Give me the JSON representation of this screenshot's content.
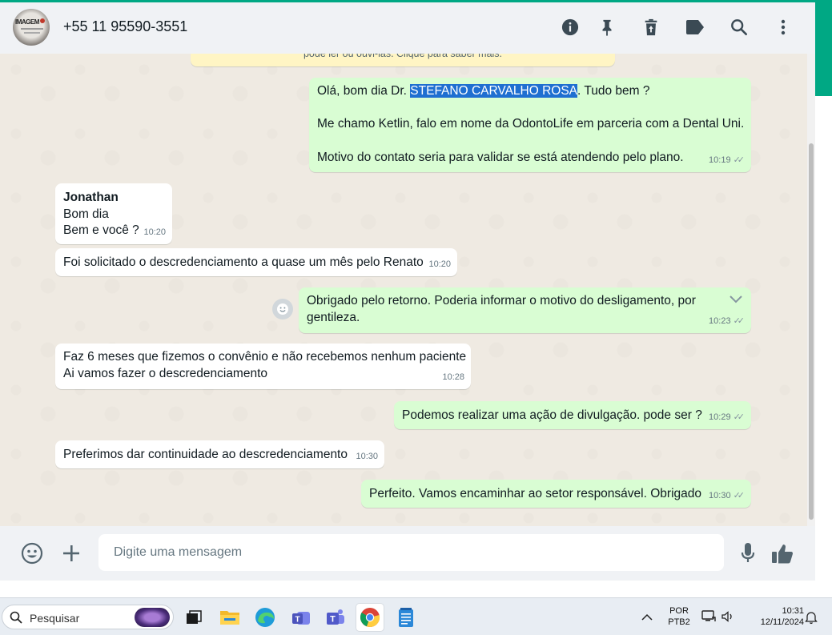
{
  "header": {
    "contact_name": "+55 11 95590-3551",
    "icons": [
      "info-icon",
      "pin-icon",
      "delete-icon",
      "label-icon",
      "search-icon",
      "more-options-icon"
    ]
  },
  "chat": {
    "encryption_notice": "pode ler ou ouvi-las. Clique para saber mais.",
    "messages": [
      {
        "direction": "out",
        "greeting_prefix": "Olá, bom dia Dr. ",
        "highlighted_name": "STEFANO CARVALHO ROSA",
        "greeting_suffix": ". Tudo bem ?",
        "line2": "Me chamo Ketlin, falo em nome da OdontoLife em parceria com a Dental Uni.",
        "line3": "Motivo do contato seria para validar se está atendendo pelo plano.",
        "time": "10:19"
      },
      {
        "direction": "in",
        "sender": "Jonathan",
        "line1": "Bom dia",
        "line2": "Bem e você ?",
        "time": "10:20"
      },
      {
        "direction": "in",
        "line1": "Foi solicitado o descredenciamento a quase um mês pelo Renato",
        "time": "10:20"
      },
      {
        "direction": "out",
        "line1": "Obrigado pelo retorno. Poderia informar o motivo do desligamento, por",
        "line2": "gentileza.",
        "time": "10:23"
      },
      {
        "direction": "in",
        "line1": "Faz 6 meses que fizemos o convênio e não recebemos nenhum paciente",
        "line2": "Ai vamos fazer o descredenciamento",
        "time": "10:28"
      },
      {
        "direction": "out",
        "line1": "Podemos realizar uma ação de divulgação. pode ser ?",
        "time": "10:29"
      },
      {
        "direction": "in",
        "line1": "Preferimos dar continuidade ao descredenciamento",
        "time": "10:30"
      },
      {
        "direction": "out",
        "line1": "Perfeito. Vamos encaminhar ao setor responsável. Obrigado",
        "time": "10:30"
      }
    ]
  },
  "compose": {
    "placeholder": "Digite uma mensagem"
  },
  "taskbar": {
    "search_label": "Pesquisar",
    "language_line1": "POR",
    "language_line2": "PTB2",
    "clock_time": "10:31",
    "clock_date": "12/11/2024"
  },
  "colors": {
    "accent": "#00a884",
    "outgoing_bubble": "#d9fdd3",
    "incoming_bubble": "#ffffff",
    "chat_background": "#efeae2",
    "selection_highlight": "#1f6fd1"
  }
}
